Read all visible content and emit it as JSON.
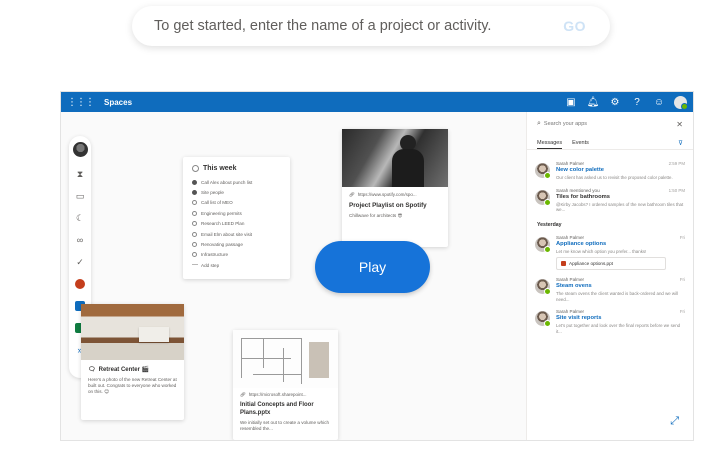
{
  "prompt": {
    "text": "To get started, enter the name of a project or activity.",
    "go_label": "GO"
  },
  "app": {
    "title": "Spaces"
  },
  "todo": {
    "title": "This week",
    "items": [
      {
        "label": "Call Alex about punch list",
        "done": true
      },
      {
        "label": "Site people",
        "done": true
      },
      {
        "label": "Call list of MEO",
        "done": false
      },
      {
        "label": "Engineering permits",
        "done": false
      },
      {
        "label": "Research LEED Plan",
        "done": false
      },
      {
        "label": "Email Elm about site visit",
        "done": false
      },
      {
        "label": "Renovating passage",
        "done": false
      },
      {
        "label": "Infrastructure",
        "done": false
      },
      {
        "label": "Add step",
        "done": false
      }
    ]
  },
  "spotify_card": {
    "link": "https://www.spotify.com/spo...",
    "title": "Project Playlist on Spotify",
    "subtitle": "Chillwave for architects 😎"
  },
  "play_label": "Play",
  "retreat_card": {
    "title": "Retreat Center 🎬",
    "body": "Here's a photo of the new Retreat Center at built out. Congrats to everyone who worked on this. 😊"
  },
  "floor_card": {
    "link": "https://microsoft.sharepoint...",
    "title": "Initial Concepts and Floor Plans.pptx",
    "body": "We initially set out to create a volume which resembled the..."
  },
  "panel": {
    "search_placeholder": "Search your apps",
    "tabs": [
      "Messages",
      "Events"
    ],
    "section_yesterday": "Yesterday",
    "messages": [
      {
        "who": "Sarah Palmer",
        "when": "2:59 PM",
        "subject": "New color palette",
        "preview": "Our client has asked us to revisit the proposed color palette.",
        "style": "link"
      },
      {
        "who": "Sarah mentioned you",
        "when": "1:50 PM",
        "subject": "Tiles for bathrooms",
        "preview": "@Kirby Jacobs? I ordered samples of the new bathroom tiles that we...",
        "style": "dark"
      },
      {
        "who": "Sarah Palmer",
        "when": "Fri",
        "subject": "Appliance options",
        "preview": "Let me know which option you prefer... thanks!",
        "style": "link",
        "attachment": "Appliance options.ppt"
      },
      {
        "who": "Sarah Palmer",
        "when": "Fri",
        "subject": "Steam ovens",
        "preview": "The steam ovens the client wanted is back-ordered and we will need...",
        "style": "link"
      },
      {
        "who": "Sarah Palmer",
        "when": "Fri",
        "subject": "Site visit reports",
        "preview": "Let's put together and look over the final reports before we send it...",
        "style": "link"
      }
    ]
  }
}
